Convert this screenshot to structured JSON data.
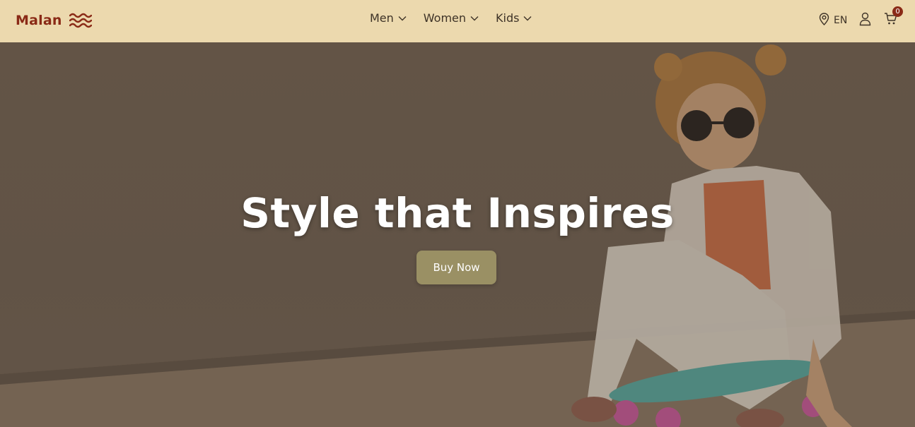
{
  "brand": {
    "name": "Malan",
    "color": "#8a2a16"
  },
  "nav": {
    "items": [
      {
        "label": "Men"
      },
      {
        "label": "Women"
      },
      {
        "label": "Kids"
      }
    ]
  },
  "header_actions": {
    "language": "EN",
    "cart_count": "0",
    "icons": [
      "location-pin-icon",
      "user-icon",
      "cart-icon"
    ]
  },
  "hero": {
    "title": "Style that Inspires",
    "button_label": "Buy Now",
    "button_color": "#9a9064"
  },
  "colors": {
    "header_bg": "#ecd9ae",
    "nav_text": "#3e3327"
  }
}
